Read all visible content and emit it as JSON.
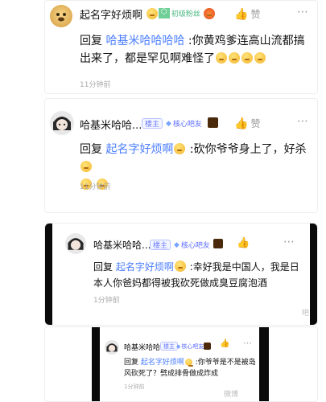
{
  "comments": [
    {
      "name": "起名字好烦啊",
      "level_badge": "初级粉丝",
      "like_label": "赞",
      "reply_prefix": "回复",
      "reply_to": "哈基米哈哈哈哈",
      "text": " :你黄鸡爹连高山流都搞出来了，都是罕见啊难怪了",
      "time": "11分钟前",
      "emoji_count": 4
    },
    {
      "name": "哈基米哈哈...",
      "host_badge": "楼主",
      "core_badge": "核心吧友",
      "like_label": "赞",
      "reply_prefix": "回复",
      "reply_to": "起名字好烦啊",
      "text": " :砍你爷爷身上了，好杀",
      "time": "11分钟前"
    },
    {
      "name": "哈基米哈哈...",
      "host_badge": "楼主",
      "core_badge": "核心吧友",
      "reply_prefix": "回复",
      "reply_to": "起名字好烦啊",
      "text": " :幸好我是中国人，我是日本人你爸妈都得被我砍死做成臭豆腐泡酒",
      "time": "1分钟前",
      "watermark": "吧"
    },
    {
      "name": "哈基米哈哈...",
      "host_badge": "楼主",
      "core_badge": "核心吧友",
      "reply_prefix": "回复",
      "reply_to": "起名字好烦啊",
      "text": " :你爷爷是不是被岛风砍死了？劈成排骨做成炸成",
      "time": "1分钟前",
      "watermark": "微博"
    }
  ],
  "colors": {
    "accent": "#4a7dff",
    "core": "#5b6cff",
    "level": "#6fcf97"
  }
}
